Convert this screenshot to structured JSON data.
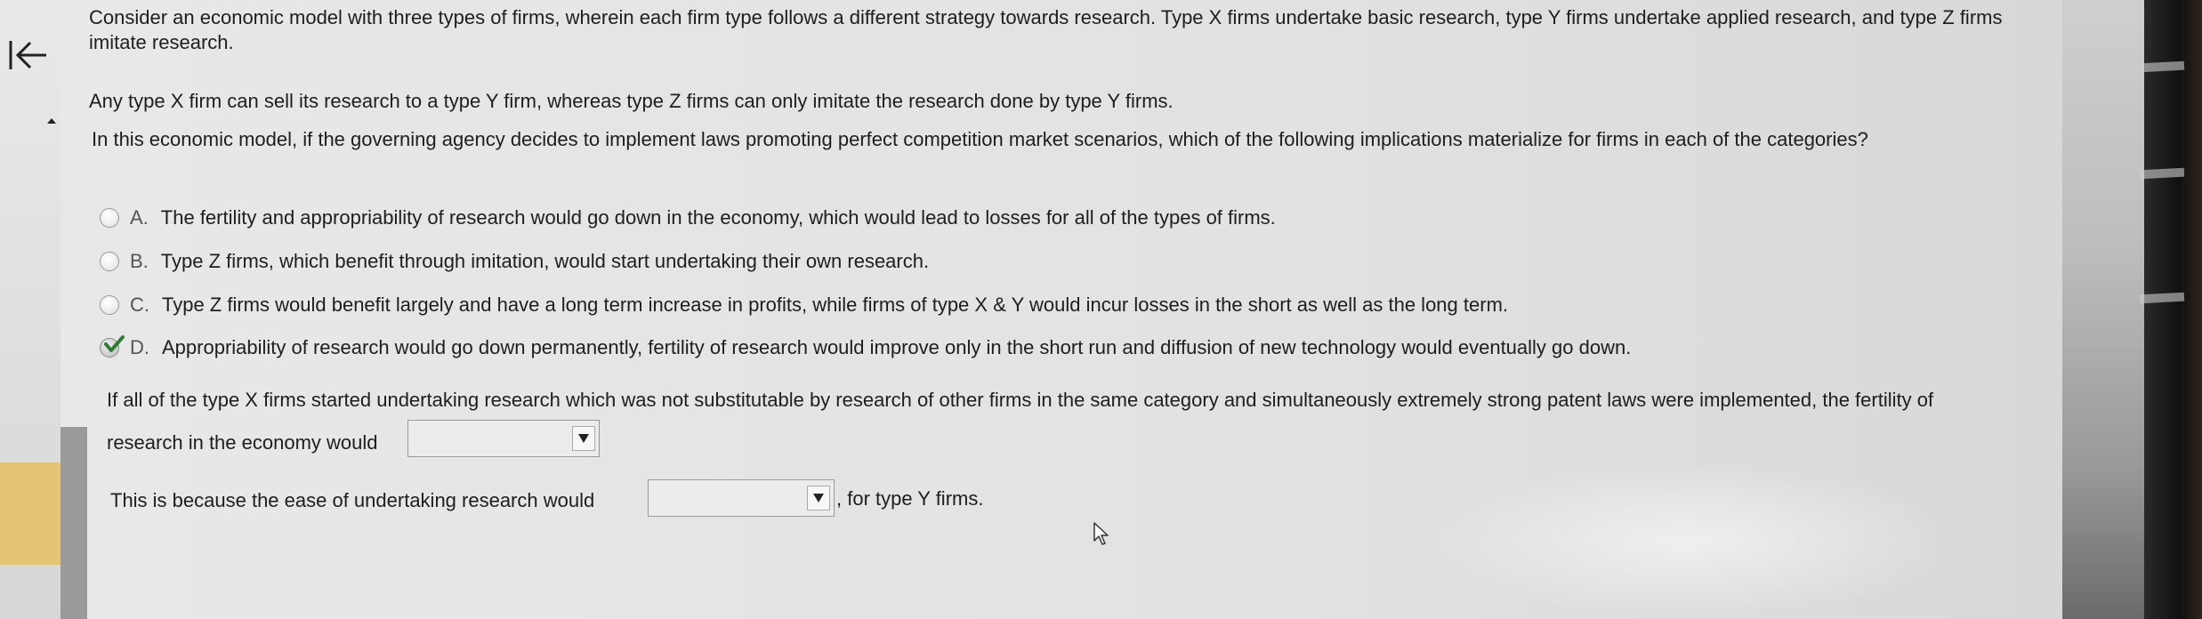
{
  "nav": {
    "back_label": "back"
  },
  "question": {
    "paragraph1": "Consider an economic model with three types of firms, wherein each firm type follows a different strategy towards research. Type X firms undertake basic research, type Y firms undertake applied research, and type Z firms imitate research.",
    "paragraph2": "Any type X firm can sell its research to a type Y firm, whereas type Z firms can only imitate the research done by type Y firms.",
    "paragraph3": "In this economic model, if the governing agency decides to implement laws promoting perfect competition market scenarios, which of the following implications materialize for firms in each of the categories?"
  },
  "options": [
    {
      "letter": "A.",
      "text": "The fertility and appropriability of research would go down in the economy, which would lead to losses for all of the types of firms.",
      "selected": false
    },
    {
      "letter": "B.",
      "text": "Type Z firms, which benefit through imitation, would start undertaking their own research.",
      "selected": false
    },
    {
      "letter": "C.",
      "text": "Type Z firms would benefit largely and have a long term increase in profits, while firms of type X & Y would incur losses in the short as well as the long term.",
      "selected": false
    },
    {
      "letter": "D.",
      "text": "Appropriability of research would go down permanently, fertility of research would improve only in the short run and diffusion of new technology would eventually go down.",
      "selected": true
    }
  ],
  "part2": {
    "line1": "If all of the type X firms started undertaking research which was not substitutable by research of other firms in the same category and simultaneously extremely strong patent laws were implemented, the fertility of",
    "line2": "research in the economy would",
    "dropdown1_value": "",
    "line3_before": "This is because the ease of undertaking research would",
    "dropdown2_value": "",
    "line3_after": ", for type Y firms."
  },
  "colors": {
    "check_green": "#2e7d32",
    "accent_yellow": "#e5c475"
  }
}
